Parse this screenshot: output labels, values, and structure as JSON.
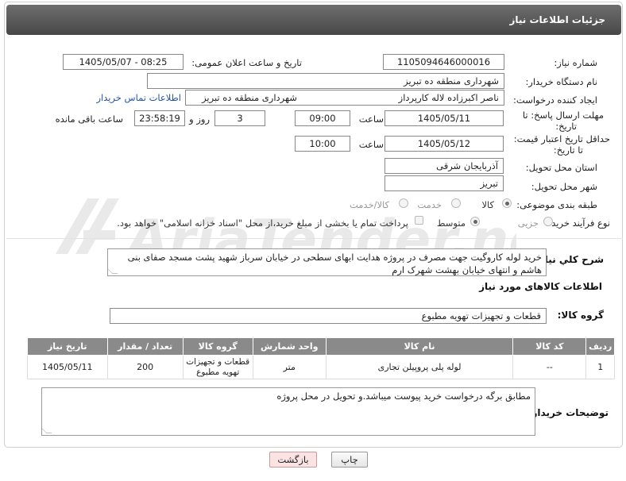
{
  "page": {
    "title": "جزئیات اطلاعات نیاز"
  },
  "watermark": {
    "text": "AriaTender.neT"
  },
  "form": {
    "need_no_label": "شماره نیاز:",
    "need_no_value": "1105094646000016",
    "announce_label": "تاریخ و ساعت اعلان عمومی:",
    "announce_value": "1405/05/07 - 08:25",
    "buyer_org_label": "نام دستگاه خریدار:",
    "buyer_org_value": "شهرداری منطقه ده تبریز",
    "creator_label": "ایجاد کننده درخواست:",
    "creator_value": "ناصر اکبرزاده لاله کارپرداز",
    "creator_org_value": "شهرداری منطقه ده تبریز",
    "contact_link": "اطلاعات تماس خریدار",
    "deadline_label_1": "مهلت ارسال پاسخ: تا",
    "deadline_label_2": "تاریخ:",
    "deadline_date": "1405/05/11",
    "time_label": "ساعت",
    "deadline_time": "09:00",
    "days_value": "3",
    "days_label": "روز و",
    "remaining_value": "23:58:19",
    "remaining_label": "ساعت باقی مانده",
    "price_label_1": "حداقل تاریخ اعتبار قیمت:",
    "price_label_2": "تا تاریخ:",
    "price_date": "1405/05/12",
    "price_time": "10:00",
    "province_label": "استان محل تحویل:",
    "province_value": "آذربایجان شرقی",
    "city_label": "شهر محل تحویل:",
    "city_value": "تبریز",
    "category_label": "طبقه بندی موضوعی:",
    "category_options": [
      "کالا",
      "خدمت",
      "کالا/خدمت"
    ],
    "category_selected": "کالا",
    "process_label": "نوع فرآیند خرید :",
    "process_options": [
      "جزیی",
      "متوسط"
    ],
    "process_selected": "متوسط",
    "payment_text": "پرداخت تمام یا بخشی از مبلغ خرید،از محل \"اسناد خزانه اسلامی\" خواهد بود."
  },
  "description": {
    "label": "شرح کلي نياز:",
    "text": "خرید لوله کاروگیت جهت مصرف در پروژه هدایت ابهای سطحی در خیابان سرباز شهید پشت مسجد صفای بنی هاشم و انتهای خیابان بهشت شهرک ارم"
  },
  "goods_section": {
    "title": "اطلاعات کالاهای مورد نیاز"
  },
  "goods_group": {
    "label": "گروه کالا:",
    "value": "قطعات و تجهیزات تهویه مطبوع"
  },
  "table": {
    "headers": [
      "ردیف",
      "کد کالا",
      "نام کالا",
      "واحد شمارش",
      "گروه کالا",
      "تعداد / مقدار",
      "تاریخ نیاز"
    ],
    "rows": [
      [
        "1",
        "--",
        "لوله پلی پروپیلن تجاری",
        "متر",
        "قطعات و تجهیزات تهویه مطبوع",
        "200",
        "1405/05/11"
      ]
    ]
  },
  "buyer_notes": {
    "label": "توضیحات خریدار:",
    "text": "مطابق برگه درخواست خرید پیوست میباشد.و تحویل در محل پروژه"
  },
  "buttons": {
    "print": "چاپ",
    "back": "بازگشت"
  },
  "colors": {
    "header_bg": "#555555",
    "table_header_bg": "#8a8a8a",
    "link": "#2255aa",
    "back_button_bg": "#fbe3e3"
  }
}
